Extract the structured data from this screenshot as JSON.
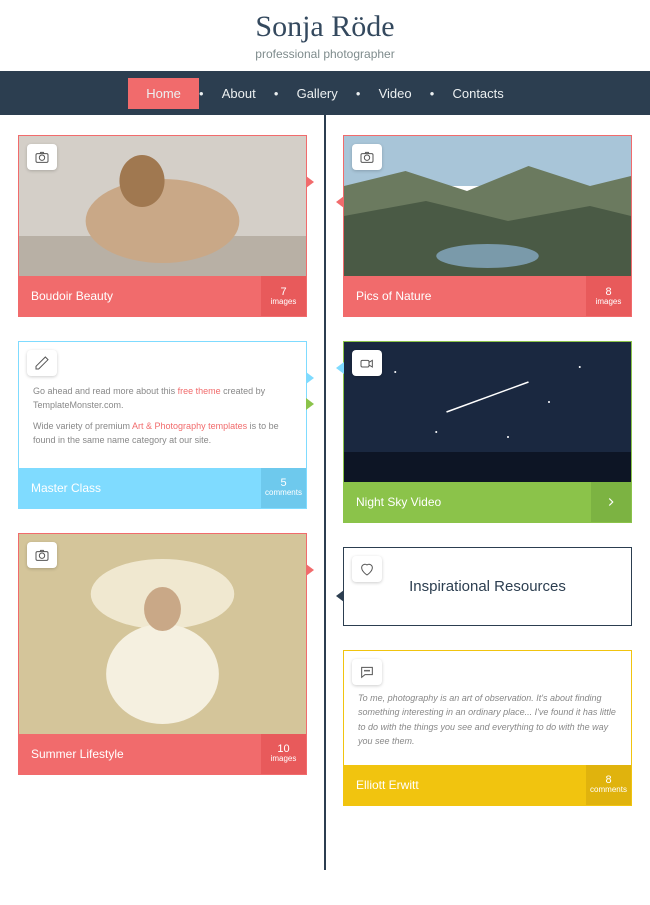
{
  "header": {
    "title": "Sonja Röde",
    "subtitle": "professional photographer"
  },
  "nav": {
    "items": [
      "Home",
      "About",
      "Gallery",
      "Video",
      "Contacts"
    ],
    "active": 0
  },
  "cards": {
    "boudoir": {
      "title": "Boudoir Beauty",
      "count": "7",
      "unit": "images"
    },
    "master": {
      "title": "Master Class",
      "count": "5",
      "unit": "comments",
      "text1": "Go ahead and read more about this ",
      "link1": "free theme",
      "text1b": " created by TemplateMonster.com.",
      "text2": "Wide variety of premium ",
      "link2": "Art & Photography templates",
      "text2b": " is to be found in the same name category at our site."
    },
    "summer": {
      "title": "Summer Lifestyle",
      "count": "10",
      "unit": "images"
    },
    "nature": {
      "title": "Pics of Nature",
      "count": "8",
      "unit": "images"
    },
    "night": {
      "title": "Night Sky Video"
    },
    "resources": {
      "title": "Inspirational Resources"
    },
    "elliott": {
      "title": "Elliott Erwitt",
      "count": "8",
      "unit": "comments",
      "quote": "To me, photography is an art of observation. It's about finding something interesting in an ordinary place... I've found it has little to do with the things you see and everything to do with the way you see them."
    }
  }
}
